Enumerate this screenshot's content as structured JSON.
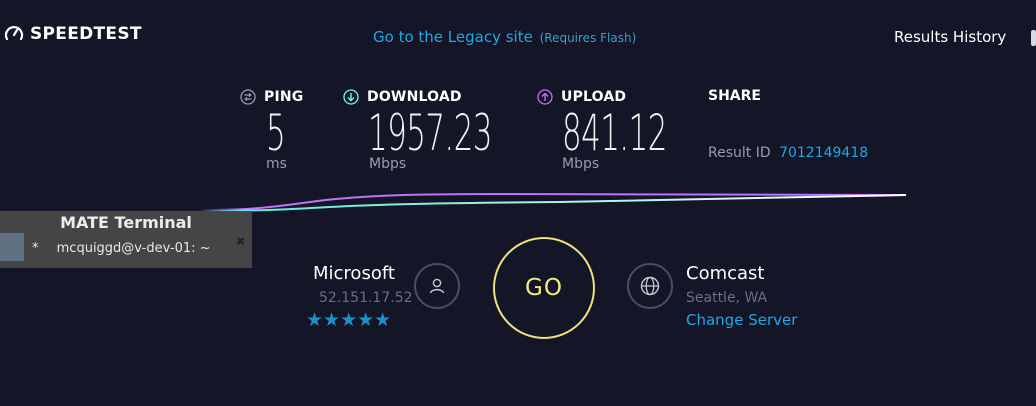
{
  "header": {
    "logo_text": "SPEEDTEST",
    "legacy_link": "Go to the Legacy site",
    "legacy_note": "(Requires Flash)",
    "history_link": "Results History"
  },
  "metrics": {
    "ping": {
      "label": "PING",
      "value": "5",
      "unit": "ms",
      "icon": "ping-icon"
    },
    "download": {
      "label": "DOWNLOAD",
      "value": "1957.23",
      "unit": "Mbps",
      "icon": "download-arrow-icon",
      "color": "#6afff3"
    },
    "upload": {
      "label": "UPLOAD",
      "value": "841.12",
      "unit": "Mbps",
      "icon": "upload-arrow-icon",
      "color": "#bf71ff"
    }
  },
  "share": {
    "title": "SHARE",
    "result_label": "Result ID",
    "result_id": "7012149418"
  },
  "terminal_overlay": {
    "title": "MATE Terminal",
    "tab_prefix": "*",
    "tab_text": "mcquiggd@v-dev-01: ~"
  },
  "provider": {
    "name": "Microsoft",
    "ip": "52.151.17.52",
    "stars": "★★★★★",
    "rating": 5,
    "icon": "user-icon"
  },
  "go_button": {
    "label": "GO",
    "color": "#ece37a"
  },
  "server": {
    "name": "Comcast",
    "location": "Seattle, WA",
    "change_link": "Change Server",
    "icon": "globe-icon"
  },
  "colors": {
    "background": "#141526",
    "accent_link": "#1ca9e6",
    "muted": "#6c6d82"
  }
}
